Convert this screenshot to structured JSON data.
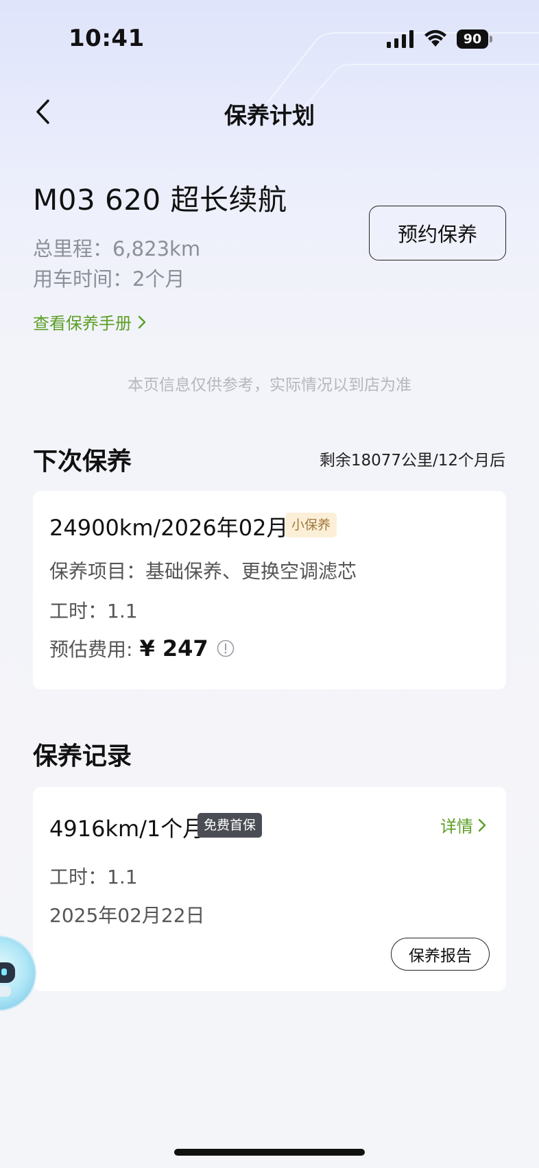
{
  "status_bar": {
    "time": "10:41",
    "battery": "90"
  },
  "nav": {
    "title": "保养计划",
    "back_icon": "chevron-left-icon"
  },
  "vehicle": {
    "name": "M03 620 超长续航",
    "mileage": "总里程：6,823km",
    "usage_time": "用车时间：2个月",
    "book_button": "预约保养",
    "manual_link": "查看保养手册"
  },
  "disclaimer": "本页信息仅供参考，实际情况以到店为准",
  "next_maintenance": {
    "title": "下次保养",
    "remaining": "剩余18077公里/12个月后",
    "date": "24900km/2026年02月",
    "tag": "小保养",
    "items": "保养项目：基础保养、更换空调滤芯",
    "hours": "工时：1.1",
    "cost_label": "预估费用:",
    "cost_value": "¥ 247"
  },
  "records": {
    "title": "保养记录",
    "items": [
      {
        "summary": "4916km/1个月",
        "tag": "免费首保",
        "detail_link": "详情",
        "hours": "工时：1.1",
        "date": "2025年02月22日",
        "report_button": "保养报告"
      }
    ]
  },
  "colors": {
    "accent_green": "#5c9e26",
    "tag_bg": "#fcefd8",
    "tag_text": "#a07a3c",
    "dark_tag_bg": "#4a4d54"
  }
}
